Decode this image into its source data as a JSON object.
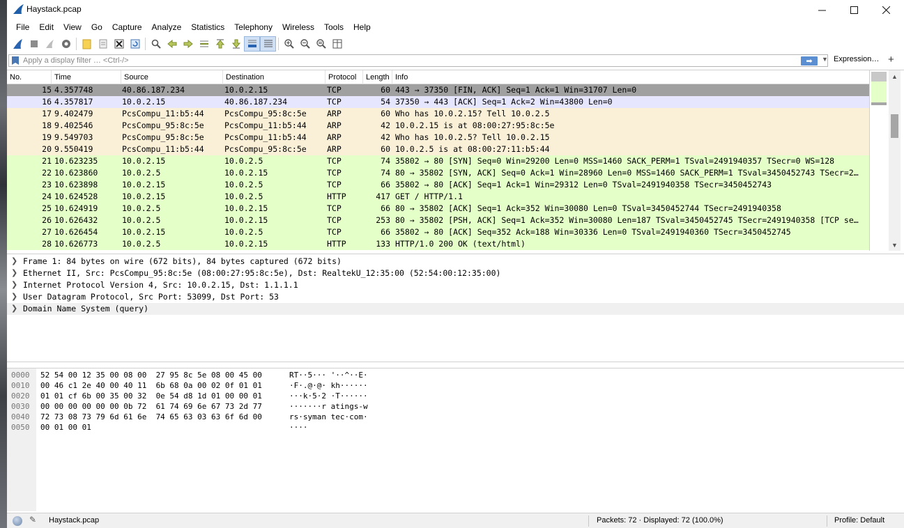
{
  "window": {
    "title": "Haystack.pcap"
  },
  "menubar": {
    "items": [
      "File",
      "Edit",
      "View",
      "Go",
      "Capture",
      "Analyze",
      "Statistics",
      "Telephony",
      "Wireless",
      "Tools",
      "Help"
    ]
  },
  "filter": {
    "placeholder": "Apply a display filter … <Ctrl-/>",
    "expression_label": "Expression…",
    "add_label": "+"
  },
  "packet_list": {
    "columns": [
      "No.",
      "Time",
      "Source",
      "Destination",
      "Protocol",
      "Length",
      "Info"
    ],
    "rows": [
      {
        "no": "15",
        "time": "4.357748",
        "src": "40.86.187.234",
        "dst": "10.0.2.15",
        "proto": "TCP",
        "len": "60",
        "info": "443 → 37350 [FIN, ACK] Seq=1 Ack=1 Win=31707 Len=0",
        "bg": "#a0a0a0"
      },
      {
        "no": "16",
        "time": "4.357817",
        "src": "10.0.2.15",
        "dst": "40.86.187.234",
        "proto": "TCP",
        "len": "54",
        "info": "37350 → 443 [ACK] Seq=1 Ack=2 Win=43800 Len=0",
        "bg": "#e7e6ff"
      },
      {
        "no": "17",
        "time": "9.402479",
        "src": "PcsCompu_11:b5:44",
        "dst": "PcsCompu_95:8c:5e",
        "proto": "ARP",
        "len": "60",
        "info": "Who has 10.0.2.15? Tell 10.0.2.5",
        "bg": "#faf0d7"
      },
      {
        "no": "18",
        "time": "9.402546",
        "src": "PcsCompu_95:8c:5e",
        "dst": "PcsCompu_11:b5:44",
        "proto": "ARP",
        "len": "42",
        "info": "10.0.2.15 is at 08:00:27:95:8c:5e",
        "bg": "#faf0d7"
      },
      {
        "no": "19",
        "time": "9.549703",
        "src": "PcsCompu_95:8c:5e",
        "dst": "PcsCompu_11:b5:44",
        "proto": "ARP",
        "len": "42",
        "info": "Who has 10.0.2.5? Tell 10.0.2.15",
        "bg": "#faf0d7"
      },
      {
        "no": "20",
        "time": "9.550419",
        "src": "PcsCompu_11:b5:44",
        "dst": "PcsCompu_95:8c:5e",
        "proto": "ARP",
        "len": "60",
        "info": "10.0.2.5 is at 08:00:27:11:b5:44",
        "bg": "#faf0d7"
      },
      {
        "no": "21",
        "time": "10.623235",
        "src": "10.0.2.15",
        "dst": "10.0.2.5",
        "proto": "TCP",
        "len": "74",
        "info": "35802 → 80 [SYN] Seq=0 Win=29200 Len=0 MSS=1460 SACK_PERM=1 TSval=2491940357 TSecr=0 WS=128",
        "bg": "#e4ffc7"
      },
      {
        "no": "22",
        "time": "10.623860",
        "src": "10.0.2.5",
        "dst": "10.0.2.15",
        "proto": "TCP",
        "len": "74",
        "info": "80 → 35802 [SYN, ACK] Seq=0 Ack=1 Win=28960 Len=0 MSS=1460 SACK_PERM=1 TSval=3450452743 TSecr=2…",
        "bg": "#e4ffc7"
      },
      {
        "no": "23",
        "time": "10.623898",
        "src": "10.0.2.15",
        "dst": "10.0.2.5",
        "proto": "TCP",
        "len": "66",
        "info": "35802 → 80 [ACK] Seq=1 Ack=1 Win=29312 Len=0 TSval=2491940358 TSecr=3450452743",
        "bg": "#e4ffc7"
      },
      {
        "no": "24",
        "time": "10.624528",
        "src": "10.0.2.15",
        "dst": "10.0.2.5",
        "proto": "HTTP",
        "len": "417",
        "info": "GET / HTTP/1.1",
        "bg": "#e4ffc7"
      },
      {
        "no": "25",
        "time": "10.624919",
        "src": "10.0.2.5",
        "dst": "10.0.2.15",
        "proto": "TCP",
        "len": "66",
        "info": "80 → 35802 [ACK] Seq=1 Ack=352 Win=30080 Len=0 TSval=3450452744 TSecr=2491940358",
        "bg": "#e4ffc7"
      },
      {
        "no": "26",
        "time": "10.626432",
        "src": "10.0.2.5",
        "dst": "10.0.2.15",
        "proto": "TCP",
        "len": "253",
        "info": "80 → 35802 [PSH, ACK] Seq=1 Ack=352 Win=30080 Len=187 TSval=3450452745 TSecr=2491940358 [TCP se…",
        "bg": "#e4ffc7"
      },
      {
        "no": "27",
        "time": "10.626454",
        "src": "10.0.2.15",
        "dst": "10.0.2.5",
        "proto": "TCP",
        "len": "66",
        "info": "35802 → 80 [ACK] Seq=352 Ack=188 Win=30336 Len=0 TSval=2491940360 TSecr=3450452745",
        "bg": "#e4ffc7"
      },
      {
        "no": "28",
        "time": "10.626773",
        "src": "10.0.2.5",
        "dst": "10.0.2.15",
        "proto": "HTTP",
        "len": "133",
        "info": "HTTP/1.0 200 OK  (text/html)",
        "bg": "#e4ffc7"
      }
    ]
  },
  "details": {
    "items": [
      "Frame 1: 84 bytes on wire (672 bits), 84 bytes captured (672 bits)",
      "Ethernet II, Src: PcsCompu_95:8c:5e (08:00:27:95:8c:5e), Dst: RealtekU_12:35:00 (52:54:00:12:35:00)",
      "Internet Protocol Version 4, Src: 10.0.2.15, Dst: 1.1.1.1",
      "User Datagram Protocol, Src Port: 53099, Dst Port: 53",
      "Domain Name System (query)"
    ]
  },
  "bytes": {
    "rows": [
      {
        "offset": "0000",
        "hex": "52 54 00 12 35 00 08 00  27 95 8c 5e 08 00 45 00",
        "ascii": "RT··5··· '··^··E·"
      },
      {
        "offset": "0010",
        "hex": "00 46 c1 2e 40 00 40 11  6b 68 0a 00 02 0f 01 01",
        "ascii": "·F·.@·@· kh······"
      },
      {
        "offset": "0020",
        "hex": "01 01 cf 6b 00 35 00 32  0e 54 d8 1d 01 00 00 01",
        "ascii": "···k·5·2 ·T······"
      },
      {
        "offset": "0030",
        "hex": "00 00 00 00 00 00 0b 72  61 74 69 6e 67 73 2d 77",
        "ascii": "·······r atings-w"
      },
      {
        "offset": "0040",
        "hex": "72 73 08 73 79 6d 61 6e  74 65 63 03 63 6f 6d 00",
        "ascii": "rs·syman tec·com·"
      },
      {
        "offset": "0050",
        "hex": "00 01 00 01",
        "ascii": "····"
      }
    ]
  },
  "status": {
    "file": "Haystack.pcap",
    "packets": "Packets: 72 · Displayed: 72 (100.0%)",
    "profile": "Profile: Default"
  }
}
